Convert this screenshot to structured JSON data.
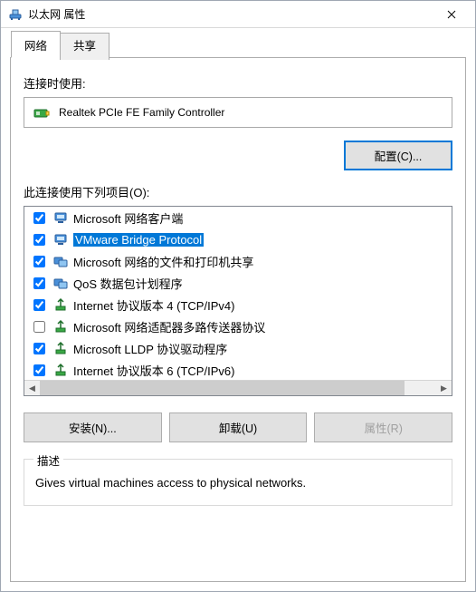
{
  "window": {
    "title": "以太网 属性"
  },
  "tabs": {
    "network": "网络",
    "sharing": "共享"
  },
  "labels": {
    "connect_using": "连接时使用:",
    "items_used": "此连接使用下列项目(O):"
  },
  "adapter": {
    "name": "Realtek PCIe FE Family Controller"
  },
  "buttons": {
    "configure": "配置(C)...",
    "install": "安装(N)...",
    "uninstall": "卸载(U)",
    "properties": "属性(R)"
  },
  "list": [
    {
      "checked": true,
      "icon": "client",
      "label": "Microsoft 网络客户端",
      "selected": false
    },
    {
      "checked": true,
      "icon": "client",
      "label": "VMware Bridge Protocol",
      "selected": true
    },
    {
      "checked": true,
      "icon": "service",
      "label": "Microsoft 网络的文件和打印机共享",
      "selected": false
    },
    {
      "checked": true,
      "icon": "service",
      "label": "QoS 数据包计划程序",
      "selected": false
    },
    {
      "checked": true,
      "icon": "protocol",
      "label": "Internet 协议版本 4 (TCP/IPv4)",
      "selected": false
    },
    {
      "checked": false,
      "icon": "protocol",
      "label": "Microsoft 网络适配器多路传送器协议",
      "selected": false
    },
    {
      "checked": true,
      "icon": "protocol",
      "label": "Microsoft LLDP 协议驱动程序",
      "selected": false
    },
    {
      "checked": true,
      "icon": "protocol",
      "label": "Internet 协议版本 6 (TCP/IPv6)",
      "selected": false
    }
  ],
  "groupbox": {
    "legend": "描述",
    "text": "Gives virtual machines access to physical networks."
  }
}
